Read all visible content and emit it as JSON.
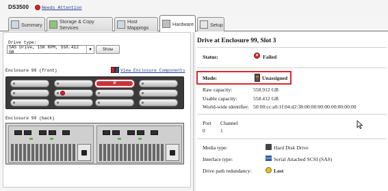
{
  "app": {
    "title": "DS3500",
    "attention_text": "Needs Attention"
  },
  "tabs": [
    {
      "label": "Summary",
      "icon": "summary-icon"
    },
    {
      "label": "Storage & Copy Services",
      "icon": "storage-icon"
    },
    {
      "label": "Host Mappings",
      "icon": "host-mappings-icon"
    },
    {
      "label": "Hardware",
      "icon": "hardware-icon",
      "active": true
    },
    {
      "label": "Setup",
      "icon": "setup-icon"
    }
  ],
  "left": {
    "drive_type_label": "Drive type:",
    "drive_type_value": "SAS Drive, 15K RPM, 558.412 GB",
    "show_button": "Show",
    "front_label": "Enclosure 99 (front)",
    "view_components_link": "View Enclosure Components",
    "back_label": "Enclosure 99 (back)"
  },
  "detail": {
    "title": "Drive at Enclosure 99, Slot 3",
    "status_label": "Status:",
    "status_value": "Failed",
    "mode_label": "Mode:",
    "mode_value": "Unassigned",
    "raw_capacity_label": "Raw capacity:",
    "raw_capacity_value": "558.912 GB",
    "usable_capacity_label": "Usable capacity:",
    "usable_capacity_value": "558.412 GB",
    "wwid_label": "World-wide identifier:",
    "wwid_value": "50:00:cc:a0:1f:04:d2:38:00:00:00:00:00:00:00:00",
    "port_header": "Port",
    "channel_header": "Channel",
    "port_value": "0",
    "channel_value": "1",
    "media_type_label": "Media type:",
    "media_type_value": "Hard Disk Drive",
    "interface_type_label": "Interface type:",
    "interface_type_value": "Serial Attached SCSI (SAS)",
    "drive_path_label": "Drive path redundancy:",
    "drive_path_value": "Lost"
  },
  "colors": {
    "failed": "#d42a30",
    "highlight": "#d7262e",
    "link": "#1f3a8f"
  }
}
